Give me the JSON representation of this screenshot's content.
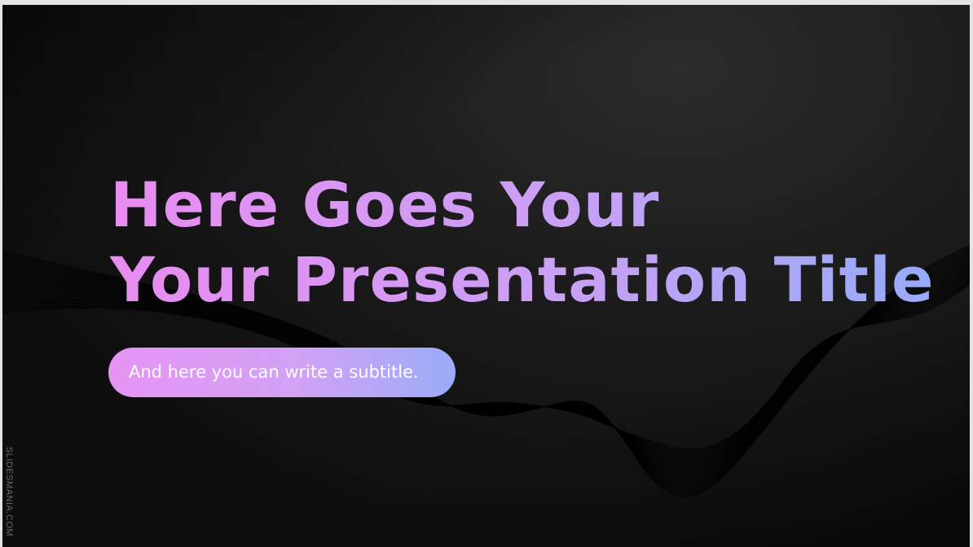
{
  "slide": {
    "title_line1": "Here Goes Your",
    "title_line2": "Your Presentation Title",
    "subtitle": "And here you can write a subtitle.",
    "brand": "SLIDESMANIA.COM"
  },
  "colors": {
    "gradient_start": "#e98cf0",
    "gradient_end": "#96abf9",
    "background": "#1c1c1c"
  }
}
